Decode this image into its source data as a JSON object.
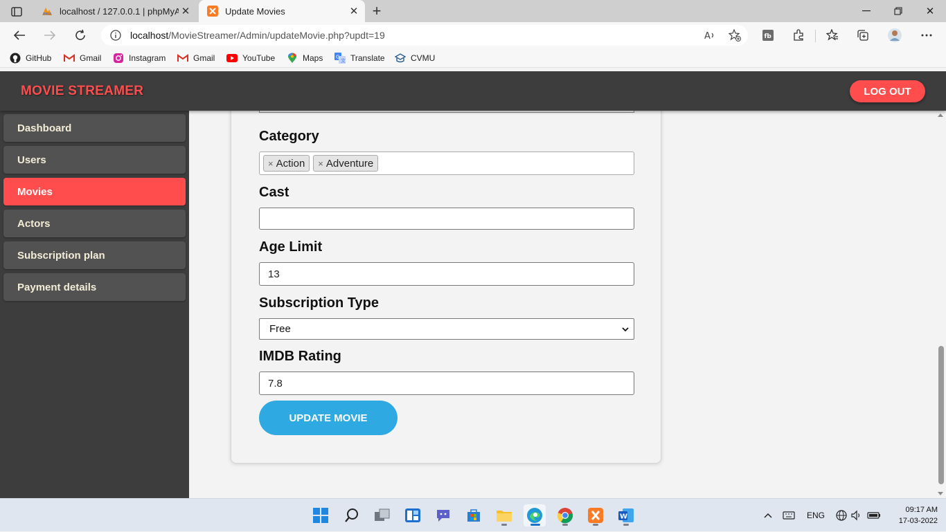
{
  "browser": {
    "tabs": [
      {
        "title": "localhost / 127.0.0.1 | phpMyAdmin"
      },
      {
        "title": "Update Movies"
      }
    ],
    "address": {
      "host": "localhost",
      "path": "/MovieStreamer/Admin/updateMovie.php?updt=19"
    },
    "bookmarks": [
      {
        "label": "GitHub"
      },
      {
        "label": "Gmail"
      },
      {
        "label": "Instagram"
      },
      {
        "label": "Gmail"
      },
      {
        "label": "YouTube"
      },
      {
        "label": "Maps"
      },
      {
        "label": "Translate"
      },
      {
        "label": "CVMU"
      }
    ]
  },
  "header": {
    "brand": "MOVIE STREAMER",
    "logout_label": "LOG OUT"
  },
  "sidebar": {
    "items": [
      {
        "label": "Dashboard"
      },
      {
        "label": "Users"
      },
      {
        "label": "Movies"
      },
      {
        "label": "Actors"
      },
      {
        "label": "Subscription plan"
      },
      {
        "label": "Payment details"
      }
    ],
    "active_index": 2
  },
  "form": {
    "category": {
      "label": "Category",
      "tags": [
        "Action",
        "Adventure"
      ],
      "remove_glyph": "×"
    },
    "cast": {
      "label": "Cast",
      "value": ""
    },
    "age_limit": {
      "label": "Age Limit",
      "value": "13"
    },
    "subscription_type": {
      "label": "Subscription Type",
      "selected": "Free"
    },
    "imdb_rating": {
      "label": "IMDB Rating",
      "value": "7.8"
    },
    "submit_label": "UPDATE MOVIE"
  },
  "taskbar": {
    "language": "ENG",
    "time": "09:17 AM",
    "date": "17-03-2022"
  },
  "colors": {
    "accent": "#ff4d4d",
    "header_bg": "#3d3d3d",
    "nav_item_bg": "#525252",
    "button_blue": "#2fa9e1"
  }
}
